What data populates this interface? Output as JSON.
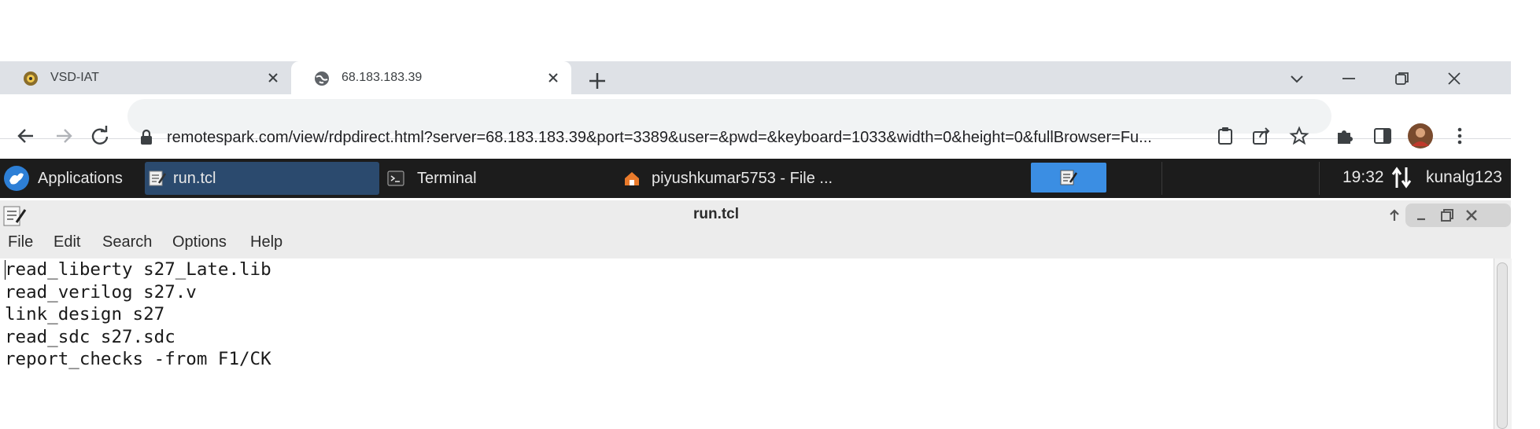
{
  "browser": {
    "tabs": [
      {
        "title": "VSD-IAT",
        "active": false,
        "favicon": "vsd-logo-icon"
      },
      {
        "title": "68.183.183.39",
        "active": true,
        "favicon": "globe-icon"
      }
    ],
    "address": {
      "url": "remotespark.com/view/rdpdirect.html?server=68.183.183.39&port=3389&user=&pwd=&keyboard=1033&width=0&height=0&fullBrowser=Fu...",
      "secure_icon": "lock-icon"
    }
  },
  "panel": {
    "applications_label": "Applications",
    "tasks": [
      {
        "label": "run.tcl",
        "icon": "text-editor-icon"
      },
      {
        "label": "Terminal",
        "icon": "terminal-icon"
      },
      {
        "label": "piyushkumar5753 - File ...",
        "icon": "home-folder-icon"
      }
    ],
    "clock": "19:32",
    "user": "kunalg123"
  },
  "editor": {
    "title": "run.tcl",
    "menu": [
      "File",
      "Edit",
      "Search",
      "Options",
      "Help"
    ],
    "content": "read_liberty s27_Late.lib\nread_verilog s27.v\nlink_design s27\nread_sdc s27.sdc\nreport_checks -from F1/CK"
  },
  "colors": {
    "tabstrip": "#dee1e6",
    "panel": "#1c1c1c",
    "active_task": "#3b8ee3",
    "focused_task": "#2b4a6e"
  }
}
